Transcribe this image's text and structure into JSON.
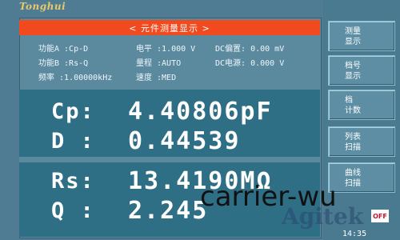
{
  "brand": "Tonghui",
  "title": "< 元件测量显示 >",
  "params": {
    "func_a": "功能A :Cp-D",
    "level": "电平  :1.000 V",
    "dc_bias": "DC偏置: 0.00  mV",
    "func_b": "功能B :Rs-Q",
    "range": "量程  :AUTO",
    "dc_source": "DC电源: 0.000 V",
    "freq": "频率  :1.00000kHz",
    "speed": "速度  :MED"
  },
  "measure": [
    {
      "label": "Cp:",
      "value": "4.40806pF"
    },
    {
      "label": "D :",
      "value": "0.44539"
    },
    {
      "label": "Rs:",
      "value": "13.4190MΩ"
    },
    {
      "label": "Q :",
      "value": "2.245"
    }
  ],
  "softkeys": [
    {
      "line1": "测量",
      "line2": "显示"
    },
    {
      "line1": "档号",
      "line2": "显示"
    },
    {
      "line1": "档",
      "line2": "计数"
    },
    {
      "line1": "列表",
      "line2": "扫描"
    },
    {
      "line1": "曲线",
      "line2": "扫描"
    }
  ],
  "clock": "14:35",
  "overlay_text": "carrier-wu",
  "watermark_text": "Agitek",
  "status_chip": "OFF",
  "colors": {
    "background": "#4f7c92",
    "title_bar": "#f04a1e",
    "measure_block": "#2f6f86",
    "text": "#ffffff"
  }
}
